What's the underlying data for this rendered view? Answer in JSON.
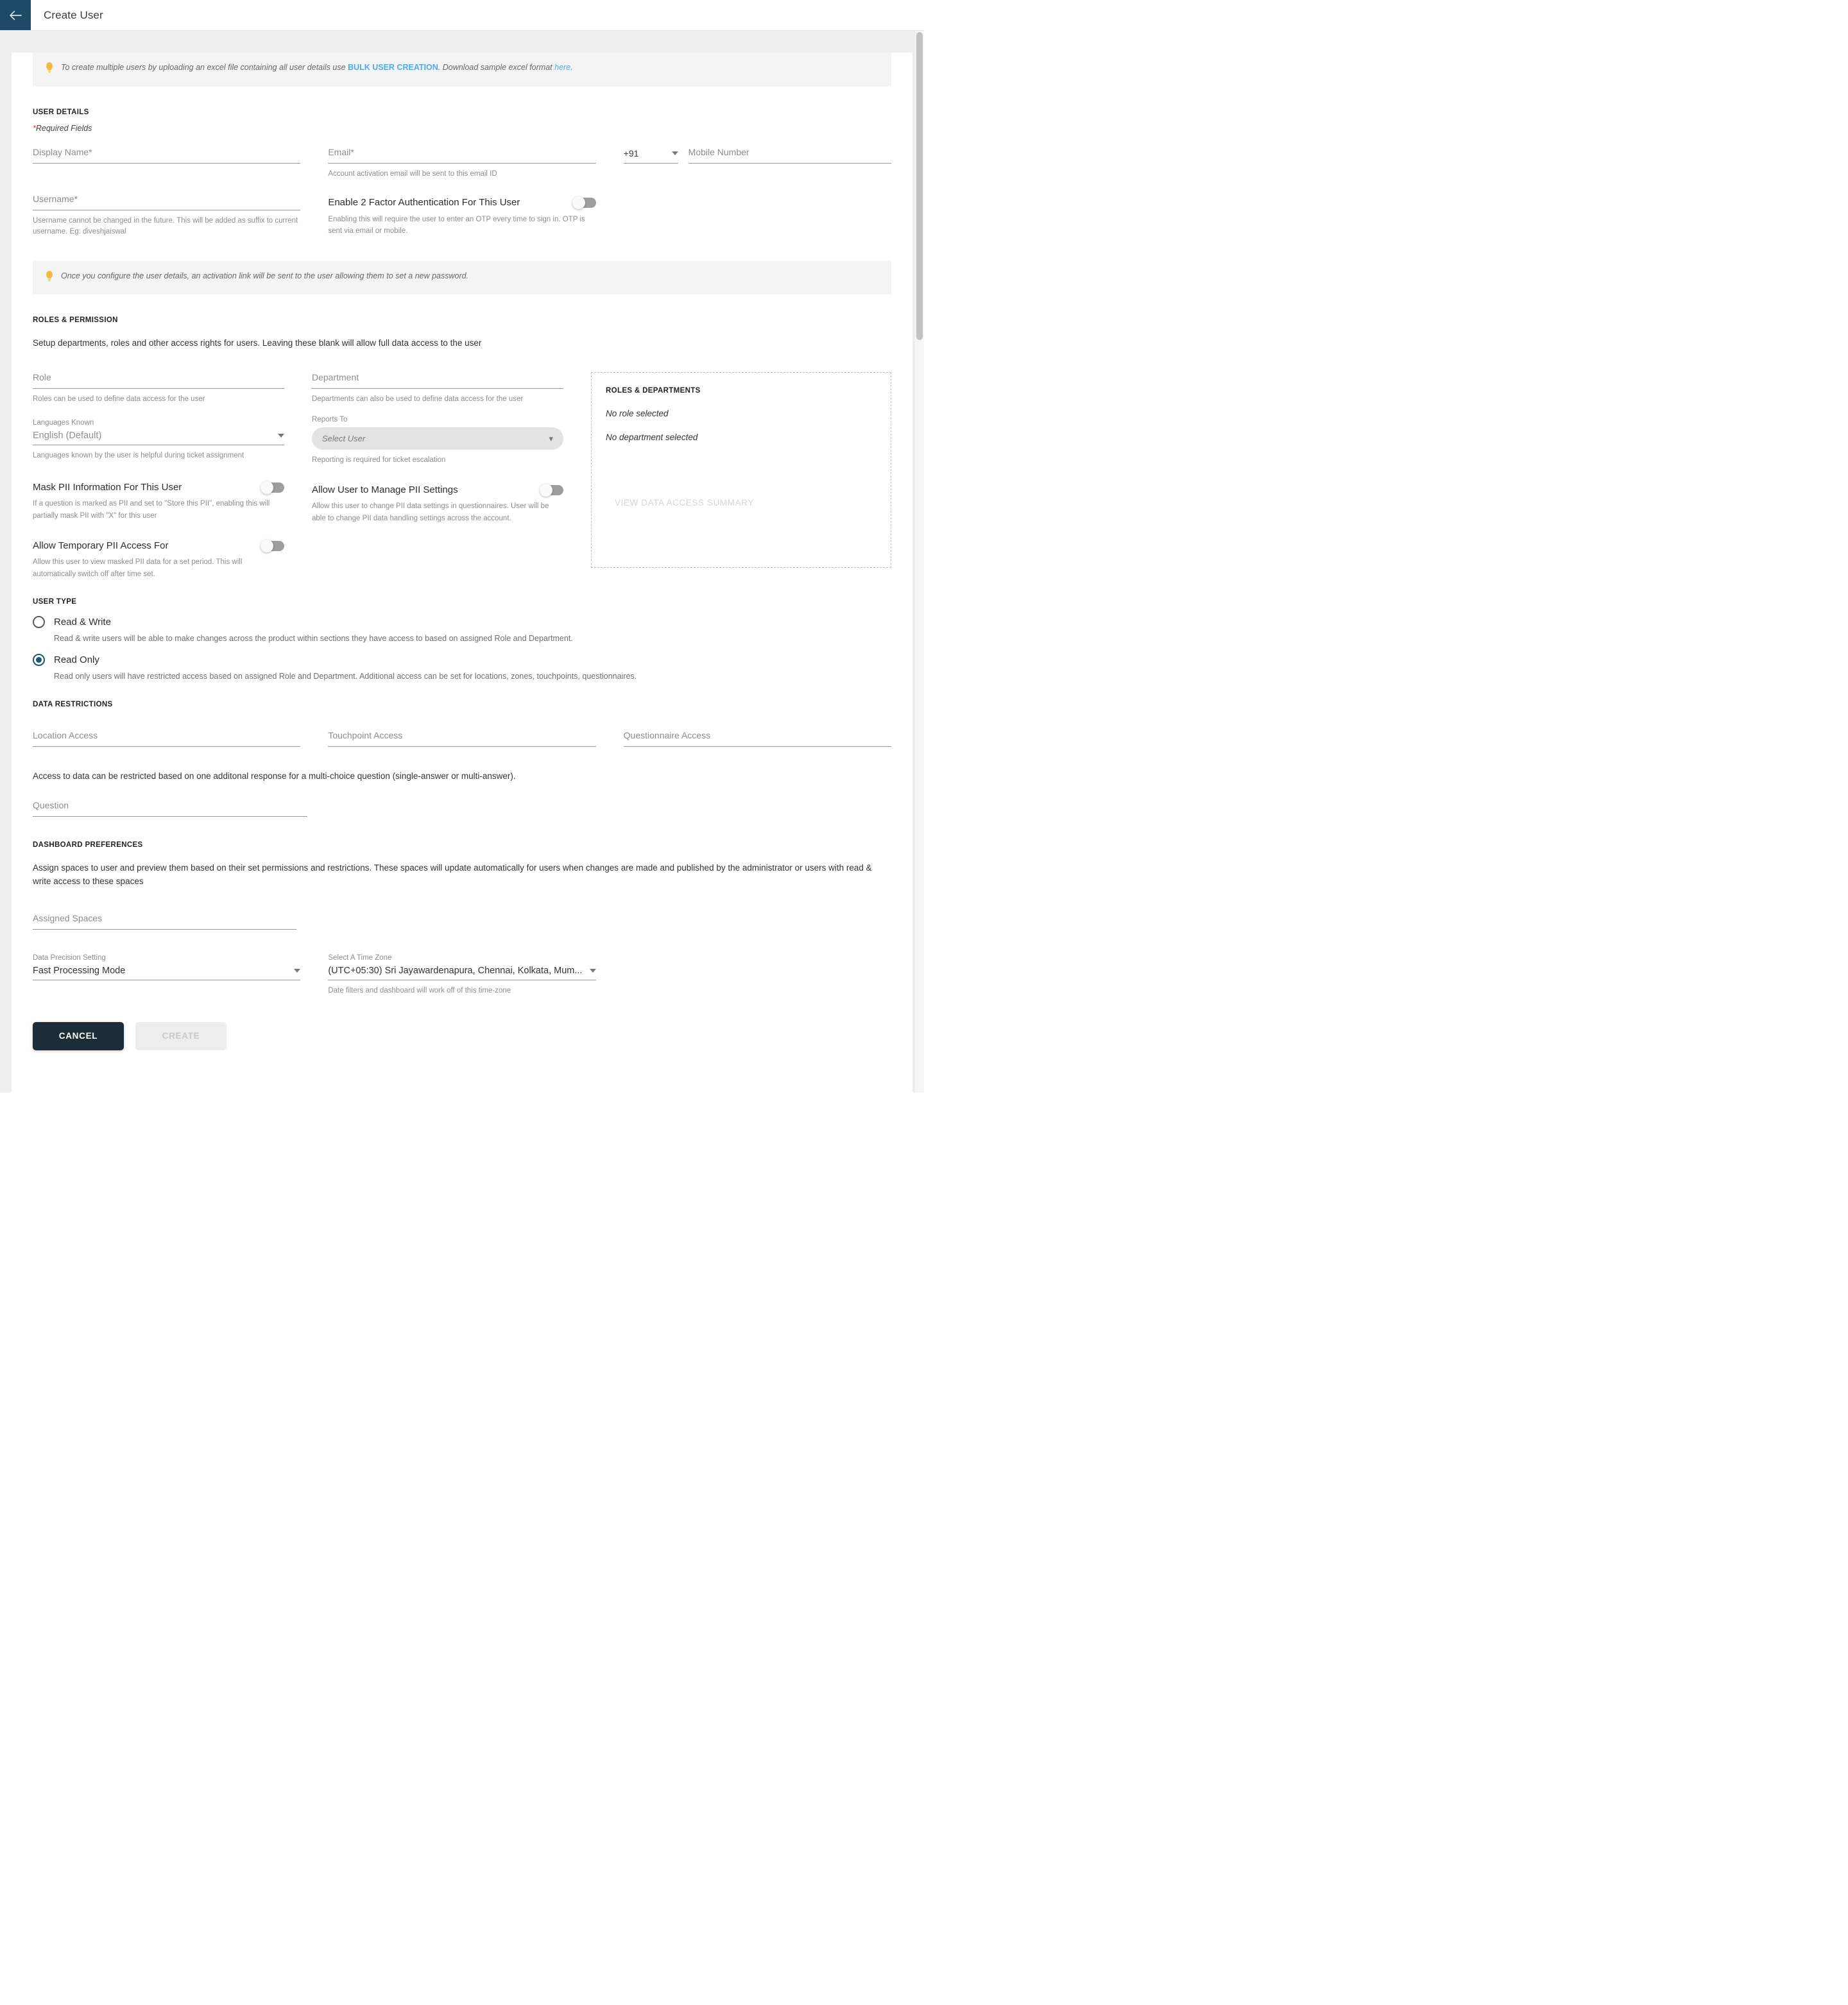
{
  "topbar": {
    "back_icon": "arrow-left-icon",
    "title": "Create User"
  },
  "banners": {
    "bulk": {
      "icon": "lightbulb-icon",
      "text_before": "To create multiple users by uploading an excel file containing all user details use ",
      "link_bulk": "BULK USER CREATION",
      "text_middle": ". Download sample excel format ",
      "link_here": "here",
      "text_after": "."
    },
    "activation": {
      "icon": "lightbulb-icon",
      "text": "Once you configure the user details, an activation link will be sent to the user allowing them to set a new password."
    }
  },
  "user_details": {
    "heading": "USER DETAILS",
    "required_star": "*",
    "required_note": "Required Fields",
    "display_name": {
      "label": "Display Name*",
      "value": ""
    },
    "email": {
      "label": "Email*",
      "value": "",
      "hint": "Account activation email will be sent to this email ID"
    },
    "country_code": {
      "value": "+91"
    },
    "mobile": {
      "placeholder": "Mobile Number",
      "value": ""
    },
    "username": {
      "label": "Username*",
      "value": "",
      "hint": "Username cannot be changed in the future. This will be added as suffix to current username. Eg: diveshjaiswal"
    },
    "two_factor": {
      "title": "Enable 2 Factor Authentication For This User",
      "hint": "Enabling this will require the user to enter an OTP every time to sign in. OTP is sent via email or mobile.",
      "state": "off"
    }
  },
  "roles_permission": {
    "heading": "ROLES & PERMISSION",
    "description": "Setup departments, roles and other access rights for users. Leaving these blank will allow full data access to the user",
    "role": {
      "label": "Role",
      "value": "",
      "hint": "Roles can be used to define data access for the user"
    },
    "department": {
      "label": "Department",
      "value": "",
      "hint": "Departments can also be used to define data access for the user"
    },
    "languages_known": {
      "label": "Languages Known",
      "value": "English (Default)",
      "hint": "Languages known by the user is helpful during ticket assignment"
    },
    "reports_to": {
      "label": "Reports To",
      "placeholder": "Select User",
      "hint": "Reporting is required for ticket escalation"
    },
    "mask_pii": {
      "title": "Mask PII Information For This User",
      "hint": "If a question is marked as PII and set to \"Store this PII\", enabling this will partially mask PII with \"X\" for this user",
      "state": "off"
    },
    "manage_pii": {
      "title": "Allow User to Manage PII Settings",
      "hint": "Allow this user to change PII data settings in questionnaires. User will be able to change PII data handling settings across the account.",
      "state": "off"
    },
    "temp_pii": {
      "title": "Allow Temporary PII Access For",
      "hint": "Allow this user to view masked PII data for a set period. This will automatically switch off after time set.",
      "state": "off"
    },
    "summary": {
      "title": "ROLES & DEPARTMENTS",
      "no_role": "No role selected",
      "no_department": "No department selected",
      "view_summary_link": "VIEW DATA ACCESS SUMMARY"
    }
  },
  "user_type": {
    "heading": "USER TYPE",
    "options": [
      {
        "label": "Read & Write",
        "hint": "Read & write users will be able to make changes across the product within sections they have access to based on assigned Role and Department.",
        "selected": false
      },
      {
        "label": "Read Only",
        "hint": "Read only users will have restricted access based on assigned Role and Department. Additional access can be set for locations, zones, touchpoints, questionnaires.",
        "selected": true
      }
    ]
  },
  "data_restrictions": {
    "heading": "DATA RESTRICTIONS",
    "location_access": {
      "label": "Location Access",
      "value": ""
    },
    "touchpoint_access": {
      "label": "Touchpoint Access",
      "value": ""
    },
    "questionnaire_access": {
      "label": "Questionnaire Access",
      "value": ""
    },
    "description": "Access to data can be restricted based on one additonal response for a multi-choice question (single-answer or multi-answer).",
    "question": {
      "label": "Question",
      "value": ""
    }
  },
  "dashboard_preferences": {
    "heading": "DASHBOARD PREFERENCES",
    "description": "Assign spaces to user and preview them based on their set permissions and restrictions. These spaces will update automatically for users when changes are made and published by the administrator or users with read & write access to these spaces",
    "assigned_spaces": {
      "label": "Assigned Spaces",
      "value": ""
    },
    "data_precision": {
      "label": "Data Precision Setting",
      "value": "Fast Processing Mode"
    },
    "time_zone": {
      "label": "Select A Time Zone",
      "value": "(UTC+05:30) Sri Jayawardenapura, Chennai, Kolkata, Mum...",
      "hint": "Date filters and dashboard will work off of this time-zone"
    }
  },
  "actions": {
    "cancel": "CANCEL",
    "create": "CREATE"
  },
  "colors": {
    "back_bar": "#1d4a66",
    "link": "#4eabe9",
    "required": "#d0342c",
    "radio_selected": "#1d5573",
    "cancel_button": "#1d2d38",
    "bulb": "#f5b943"
  }
}
